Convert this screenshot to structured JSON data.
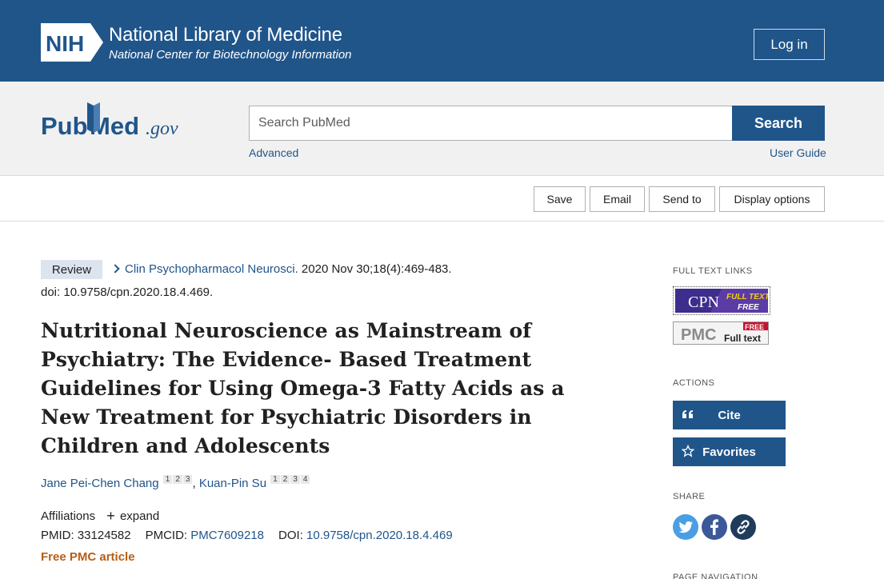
{
  "header": {
    "nih_logo_text": "NIH",
    "title": "National Library of Medicine",
    "subtitle": "National Center for Biotechnology Information",
    "login_label": "Log in",
    "brand_color": "#20558a"
  },
  "search": {
    "logo_text": "PubMed.gov",
    "logo_parts": [
      "Pub",
      "Med",
      ".gov"
    ],
    "placeholder": "Search PubMed",
    "button_label": "Search",
    "advanced_label": "Advanced",
    "user_guide_label": "User Guide"
  },
  "toolbar": {
    "save_label": "Save",
    "email_label": "Email",
    "send_to_label": "Send to",
    "display_options_label": "Display options"
  },
  "article": {
    "type_badge": "Review",
    "journal": "Clin Psychopharmacol Neurosci.",
    "citation": " 2020 Nov 30;18(4):469-483.",
    "doi_line": "doi: 10.9758/cpn.2020.18.4.469.",
    "title": "Nutritional Neuroscience as Mainstream of Psychiatry: The Evidence- Based Treatment Guidelines for Using Omega-3 Fatty Acids as a New Treatment for Psychiatric Disorders in Children and Adolescents",
    "authors": [
      {
        "name": "Jane Pei-Chen Chang",
        "affiliations": [
          "1",
          "2",
          "3"
        ]
      },
      {
        "name": "Kuan-Pin Su",
        "affiliations": [
          "1",
          "2",
          "3",
          "4"
        ]
      }
    ],
    "author_separator": ", ",
    "affiliations_label": "Affiliations",
    "expand_label": "expand",
    "pmid_label": "PMID:",
    "pmid": "33124582",
    "pmcid_label": "PMCID:",
    "pmcid": "PMC7609218",
    "doi_label": "DOI:",
    "doi": "10.9758/cpn.2020.18.4.469",
    "free_label": "Free PMC article",
    "free_color": "#b55f14"
  },
  "sidebar": {
    "full_text_heading": "FULL TEXT LINKS",
    "cpn_badge": {
      "abbr": "CPN",
      "line1": "FULL TEXT",
      "line2": "FREE"
    },
    "pmc_badge": {
      "abbr": "PMC",
      "free": "FREE",
      "text": "Full text"
    },
    "actions_heading": "ACTIONS",
    "cite_label": "Cite",
    "favorites_label": "Favorites",
    "share_heading": "SHARE",
    "share_icons": [
      "twitter-icon",
      "facebook-icon",
      "permalink-icon"
    ],
    "page_nav_heading": "PAGE NAVIGATION"
  }
}
